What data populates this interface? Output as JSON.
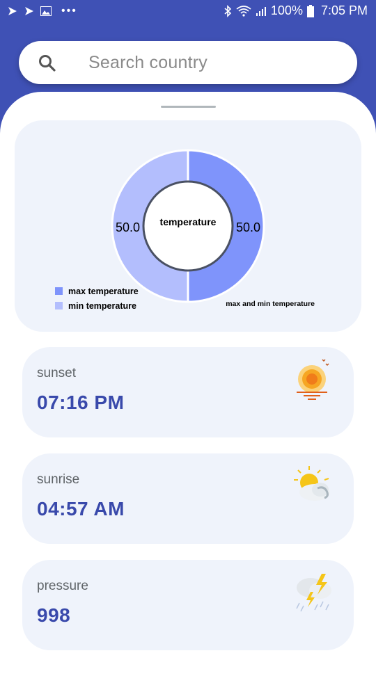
{
  "status_bar": {
    "battery": "100%",
    "time": "7:05 PM"
  },
  "search": {
    "placeholder": "Search country"
  },
  "chart_data": {
    "type": "pie",
    "title": "temperature",
    "categories": [
      "max temperature",
      "min temperature"
    ],
    "values": [
      50.0,
      50.0
    ],
    "value_labels": [
      "50.0",
      "50.0"
    ],
    "colors": [
      "#7f94fb",
      "#b3befd"
    ],
    "description": "max and min temperature",
    "legend_placement": "bottom-left"
  },
  "cards": [
    {
      "label": "sunset",
      "value": "07:16 PM",
      "icon": "sunset-icon"
    },
    {
      "label": "sunrise",
      "value": "04:57 AM",
      "icon": "sun-cloud-icon"
    },
    {
      "label": "pressure",
      "value": "998",
      "icon": "thunderstorm-icon"
    }
  ]
}
